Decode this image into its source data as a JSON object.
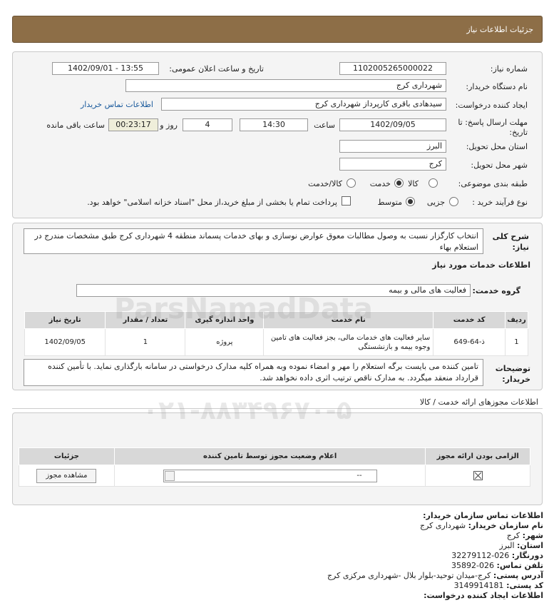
{
  "header": {
    "title": "جزئیات اطلاعات نیاز"
  },
  "form": {
    "need_number_label": "شماره نیاز:",
    "need_number": "1102005265000022",
    "announce_label": "تاریخ و ساعت اعلان عمومی:",
    "announce_value": "1402/09/01 - 13:55",
    "buyer_org_label": "نام دستگاه خریدار:",
    "buyer_org": "شهرداری کرج",
    "creator_label": "ایجاد کننده درخواست:",
    "creator": "سیدهادی باقری کارپرداز شهرداری کرج",
    "contact_link": "اطلاعات تماس خریدار",
    "deadline_label": "مهلت ارسال پاسخ: تا",
    "deadline_label2": "تاریخ:",
    "deadline_date": "1402/09/05",
    "time_label": "ساعت",
    "deadline_time": "14:30",
    "days_value": "4",
    "days_label": "روز و",
    "remaining_time": "00:23:17",
    "remaining_label": "ساعت باقی مانده",
    "province_label": "استان محل تحویل:",
    "province": "البرز",
    "city_label": "شهر محل تحویل:",
    "city": "کرج",
    "category_label": "طبقه بندی موضوعی:",
    "category_options": [
      "کالا",
      "خدمت",
      "کالا/خدمت"
    ],
    "purchase_type_label": "نوع فرآیند خرید :",
    "purchase_options": [
      "جزیی",
      "متوسط"
    ],
    "treasury_text": "پرداخت تمام یا بخشی از مبلغ خرید،از محل \"اسناد خزانه اسلامی\" خواهد بود."
  },
  "description": {
    "label": "شرح کلی نیاز:",
    "text": "انتخاب کارگزار نسبت به وصول مطالبات معوق عوارض نوسازی و بهای خدمات پسماند منطقه 4 شهرداری کرج طبق مشخصات مندرج در استعلام بهاء"
  },
  "services": {
    "section_title": "اطلاعات خدمات مورد نیاز",
    "group_label": "گروه خدمت:",
    "group_value": "فعالیت  های مالی و بیمه",
    "columns": [
      "ردیف",
      "کد خدمت",
      "نام خدمت",
      "واحد اندازه گیری",
      "تعداد / مقدار",
      "تاریخ نیاز"
    ],
    "rows": [
      {
        "row": "1",
        "code": "ذ-64-649",
        "name": "سایر فعالیت های خدمات مالی، بجز فعالیت های تامین وجوه بیمه و بازنشستگی",
        "unit": "پروژه",
        "qty": "1",
        "date": "1402/09/05"
      }
    ]
  },
  "buyer_notes": {
    "label": "توضیحات خریدار:",
    "text": "تامین کننده می بایست برگه استعلام را مهر و امضاء نموده وبه همراه کلیه مدارک درخواستی در سامانه بارگذاری نماید. با تأمین کننده قرارداد منعقد میگردد. به مدارک ناقص ترتیب اثری داده نخواهد شد."
  },
  "permits": {
    "section_title": "اطلاعات مجوزهای ارائه خدمت / کالا",
    "columns": [
      "الزامی بودن ارائه مجوز",
      "اعلام وضعیت مجوز توسط تامین کننده",
      "جزئیات"
    ],
    "select_value": "--",
    "view_button": "مشاهده مجوز"
  },
  "contact": {
    "title": "اطلاعات تماس سازمان خریدار:",
    "org_label": "نام سازمان خریدار:",
    "org_value": "شهرداری کرج",
    "city_label": "شهر:",
    "city_value": "کرج",
    "province_label": "استان:",
    "province_value": "البرز",
    "fax_label": "دورنگار:",
    "fax_value": "026-32279112",
    "phone_label": "تلفن تماس:",
    "phone_value": "026-35892",
    "address_label": "آدرس پستی:",
    "address_value": "کرج-میدان توحید-بلوار بلال -شهرداری مرکزی کرج",
    "postal_label": "کد پستی:",
    "postal_value": "3149914181",
    "creator_title": "اطلاعات ایجاد کننده درخواست:"
  },
  "watermark": {
    "line1": "ParsNamadData",
    "line2": "۰۲۱-۸۸۳۴۹۶۷۰-۵"
  }
}
